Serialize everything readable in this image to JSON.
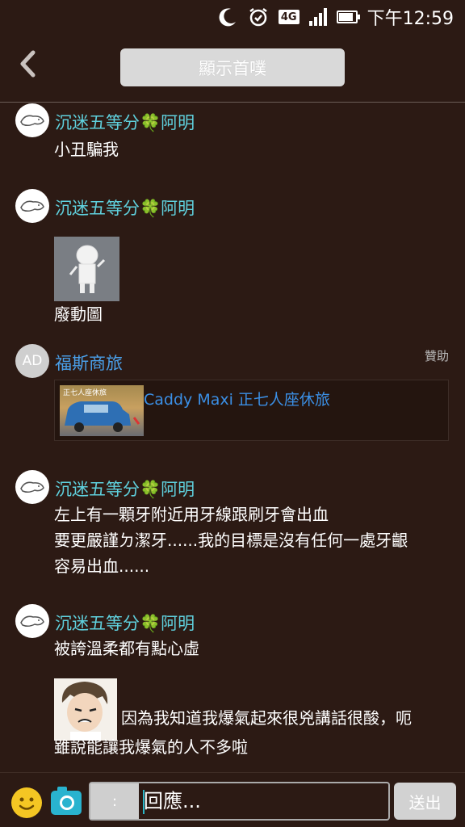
{
  "status": {
    "moon_icon": "moon-icon",
    "alarm_icon": "alarm-icon",
    "network_label": "4G",
    "time": "下午12:59"
  },
  "header": {
    "back_icon": "chevron-left-icon",
    "title": "顯示首噗"
  },
  "posts": [
    {
      "author": "沉迷五等分",
      "clover": "🍀",
      "author_suffix": "阿明",
      "message": "小丑騙我"
    },
    {
      "author": "沉迷五等分",
      "clover": "🍀",
      "author_suffix": "阿明",
      "message": "廢動圖"
    },
    {
      "author": "沉迷五等分",
      "clover": "🍀",
      "author_suffix": "阿明",
      "lines": [
        "左上有一顆牙附近用牙線跟刷牙會出血",
        "要更嚴謹ㄉ潔牙......我的目標是沒有任何一處牙齦",
        "容易出血......"
      ]
    },
    {
      "author": "沉迷五等分",
      "clover": "🍀",
      "author_suffix": "阿明",
      "message": "被誇溫柔都有點心虛",
      "lines2": [
        "因為我知道我爆氣起來很兇講話很酸，呃",
        "雖說能讓我爆氣的人不多啦"
      ]
    }
  ],
  "ad": {
    "avatar_label": "AD",
    "advertiser": "福斯商旅",
    "sponsored_label": "贊助",
    "headline": "Caddy Maxi 正七人座休旅",
    "image_caption": "正七人座休旅"
  },
  "composer": {
    "emoji_icon": "smiley-icon",
    "camera_icon": "camera-icon",
    "prefix": ":",
    "placeholder": "回應...",
    "send_label": "送出"
  },
  "colors": {
    "background": "#2c1a14",
    "username": "#5fd0dd",
    "ad_name": "#4aa0ea",
    "link": "#3b8fe5"
  }
}
